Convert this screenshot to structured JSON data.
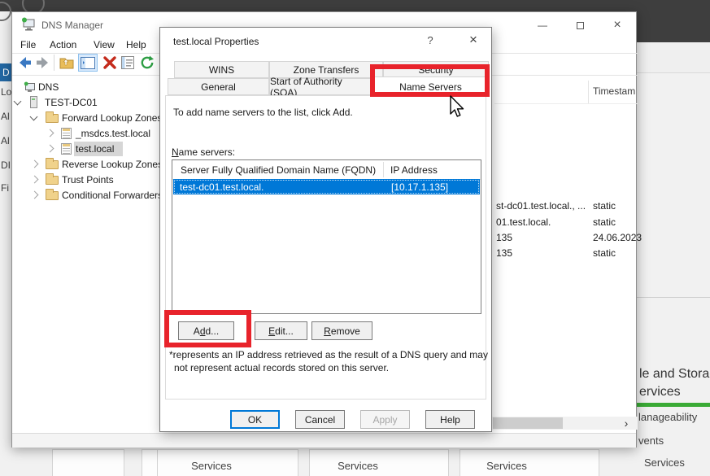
{
  "colors": {
    "annotation": "#e8232b",
    "selection": "#0078d7",
    "nav_selected": "#2368a4",
    "status_green": "#3aaa35"
  },
  "server_manager": {
    "nav_items": [
      {
        "label": "D",
        "selected": true
      },
      {
        "label": "Lo",
        "selected": false
      },
      {
        "label": "Al",
        "selected": false
      },
      {
        "label": "Al",
        "selected": false
      },
      {
        "label": "DI",
        "selected": false
      },
      {
        "label": "Fi",
        "selected": false
      }
    ],
    "right_tile": {
      "heading_line1": "le and Storag",
      "heading_line2": "ervices",
      "rows": [
        "lanageability",
        "vents",
        "Services"
      ]
    },
    "bottom_tiles": [
      {
        "label": "Services"
      },
      {
        "label": "Services"
      },
      {
        "label": "Services"
      }
    ]
  },
  "dns_manager": {
    "title": "DNS Manager",
    "window_controls": {
      "minimize": "—",
      "close": "×"
    },
    "menu": [
      {
        "label": "File"
      },
      {
        "label": "Action"
      },
      {
        "label": "View"
      },
      {
        "label": "Help"
      }
    ],
    "tree": [
      {
        "label": "DNS"
      },
      {
        "label": "TEST-DC01"
      },
      {
        "label": "Forward Lookup Zones"
      },
      {
        "label": "_msdcs.test.local"
      },
      {
        "label": "test.local",
        "selected": true
      },
      {
        "label": "Reverse Lookup Zones"
      },
      {
        "label": "Trust Points"
      },
      {
        "label": "Conditional Forwarders"
      }
    ],
    "right_pane": {
      "timestamp_header": "Timestam",
      "rows": [
        {
          "name": "st-dc01.test.local., ...",
          "timestamp": "static"
        },
        {
          "name": "01.test.local.",
          "timestamp": "static"
        },
        {
          "name": "135",
          "timestamp": "24.06.2023"
        },
        {
          "name": "135",
          "timestamp": "static"
        }
      ],
      "scroll_arrow": "›"
    }
  },
  "dialog": {
    "title": "test.local Properties",
    "help_glyph": "?",
    "close_glyph": "×",
    "tabs_row1": [
      {
        "label": "WINS"
      },
      {
        "label": "Zone Transfers"
      },
      {
        "label": "Security"
      }
    ],
    "tabs_row2": [
      {
        "label": "General"
      },
      {
        "label": "Start of Authority (SOA)"
      },
      {
        "label": "Name Servers",
        "active": true
      }
    ],
    "instruction": "To add name servers to the list, click Add.",
    "list_label": {
      "key": "N",
      "post": "ame servers:"
    },
    "list_columns": [
      {
        "label": "Server Fully Qualified Domain Name (FQDN)"
      },
      {
        "label": "IP Address"
      }
    ],
    "list_rows": [
      {
        "fqdn": "test-dc01.test.local.",
        "ip": "[10.17.1.135]",
        "selected": true
      }
    ],
    "buttons": {
      "add_pre": "A",
      "add_key": "d",
      "add_post": "d...",
      "edit_key": "E",
      "edit_post": "dit...",
      "remove_key": "R",
      "remove_post": "emove",
      "ok": "OK",
      "cancel": "Cancel",
      "apply": "Apply",
      "help": "Help"
    },
    "note_line1": "*represents an IP address retrieved as the result of a DNS query and may",
    "note_line2": "not represent actual records stored on this server."
  }
}
